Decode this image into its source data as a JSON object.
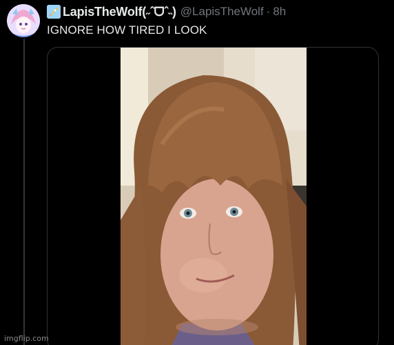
{
  "tweet": {
    "display_name": "LapisTheWolf(˶ˆᗜˆ˵)",
    "handle": "@LapisTheWolf",
    "separator": "·",
    "time": "8h",
    "text": "IGNORE HOW TIRED I LOOK",
    "avatar_icon": "anime-avatar-icon",
    "name_emoji_icon": "rocket-icon"
  },
  "watermark": {
    "text": "imgflip.com"
  },
  "colors": {
    "background": "#000000",
    "primary_text": "#e7e9ea",
    "secondary_text": "#71767b",
    "border": "#2f3336"
  }
}
